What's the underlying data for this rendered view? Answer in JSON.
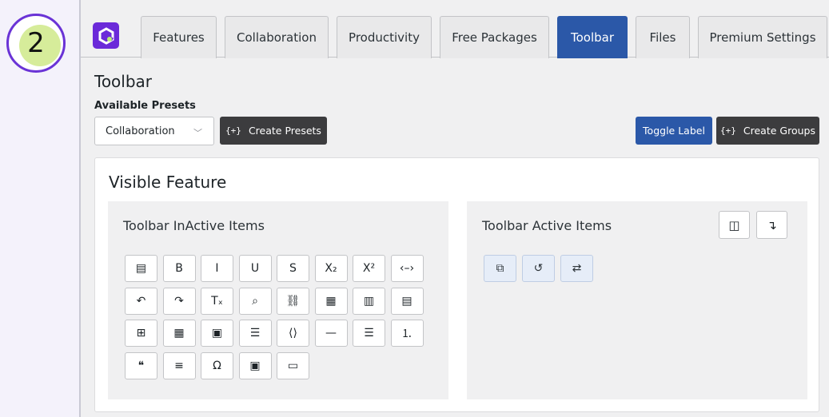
{
  "step_number": "2",
  "tabs": [
    {
      "label": "Features",
      "active": false
    },
    {
      "label": "Collaboration",
      "active": false
    },
    {
      "label": "Productivity",
      "active": false
    },
    {
      "label": "Free Packages",
      "active": false
    },
    {
      "label": "Toolbar",
      "active": true
    },
    {
      "label": "Files",
      "active": false
    },
    {
      "label": "Premium Settings",
      "active": false
    }
  ],
  "page_title": "Toolbar",
  "presets": {
    "label": "Available Presets",
    "selected": "Collaboration",
    "create_presets_label": "Create Presets"
  },
  "actions": {
    "toggle_label": "Toggle Label",
    "create_groups_label": "Create Groups"
  },
  "card": {
    "title": "Visible Feature",
    "inactive_title": "Toolbar InActive Items",
    "active_title": "Toolbar Active Items"
  },
  "inactive_items": [
    {
      "icon": "comment-icon",
      "glyph": "▤"
    },
    {
      "icon": "bold-icon",
      "glyph": "B"
    },
    {
      "icon": "italic-icon",
      "glyph": "I"
    },
    {
      "icon": "underline-icon",
      "glyph": "U"
    },
    {
      "icon": "strikethrough-icon",
      "glyph": "S"
    },
    {
      "icon": "subscript-icon",
      "glyph": "X₂"
    },
    {
      "icon": "superscript-icon",
      "glyph": "X²"
    },
    {
      "icon": "code-icon",
      "glyph": "‹–›"
    },
    {
      "icon": "undo-icon",
      "glyph": "↶"
    },
    {
      "icon": "redo-icon",
      "glyph": "↷"
    },
    {
      "icon": "remove-format-icon",
      "glyph": "Tₓ"
    },
    {
      "icon": "find-replace-icon",
      "glyph": "⌕"
    },
    {
      "icon": "link-icon",
      "glyph": "⛓"
    },
    {
      "icon": "table-icon",
      "glyph": "▦"
    },
    {
      "icon": "table-column-icon",
      "glyph": "▥"
    },
    {
      "icon": "table-row-icon",
      "glyph": "▤"
    },
    {
      "icon": "table-merge-icon",
      "glyph": "⊞"
    },
    {
      "icon": "table-properties-icon",
      "glyph": "▦"
    },
    {
      "icon": "cell-properties-icon",
      "glyph": "▣"
    },
    {
      "icon": "align-justify-box-icon",
      "glyph": "☰"
    },
    {
      "icon": "source-edit-icon",
      "glyph": "⟨⟩"
    },
    {
      "icon": "horizontal-line-icon",
      "glyph": "—"
    },
    {
      "icon": "bulleted-list-icon",
      "glyph": "☰"
    },
    {
      "icon": "numbered-list-icon",
      "glyph": "⒈"
    },
    {
      "icon": "blockquote-icon",
      "glyph": "❝"
    },
    {
      "icon": "align-center-icon",
      "glyph": "≡"
    },
    {
      "icon": "special-characters-icon",
      "glyph": "Ω"
    },
    {
      "icon": "image-icon",
      "glyph": "▣"
    },
    {
      "icon": "page-break-icon",
      "glyph": "▭"
    }
  ],
  "active_items": [
    {
      "icon": "track-changes-icon",
      "glyph": "⧉"
    },
    {
      "icon": "revision-history-icon",
      "glyph": "↺"
    },
    {
      "icon": "compare-icon",
      "glyph": "⇄"
    }
  ],
  "controls": [
    {
      "icon": "columns-icon",
      "glyph": "◫"
    },
    {
      "icon": "arrow-down-icon",
      "glyph": "↴"
    }
  ],
  "colors": {
    "brand_purple": "#6b2ad9",
    "active_tab": "#2b58a8",
    "dark_button": "#3c3c3e"
  }
}
